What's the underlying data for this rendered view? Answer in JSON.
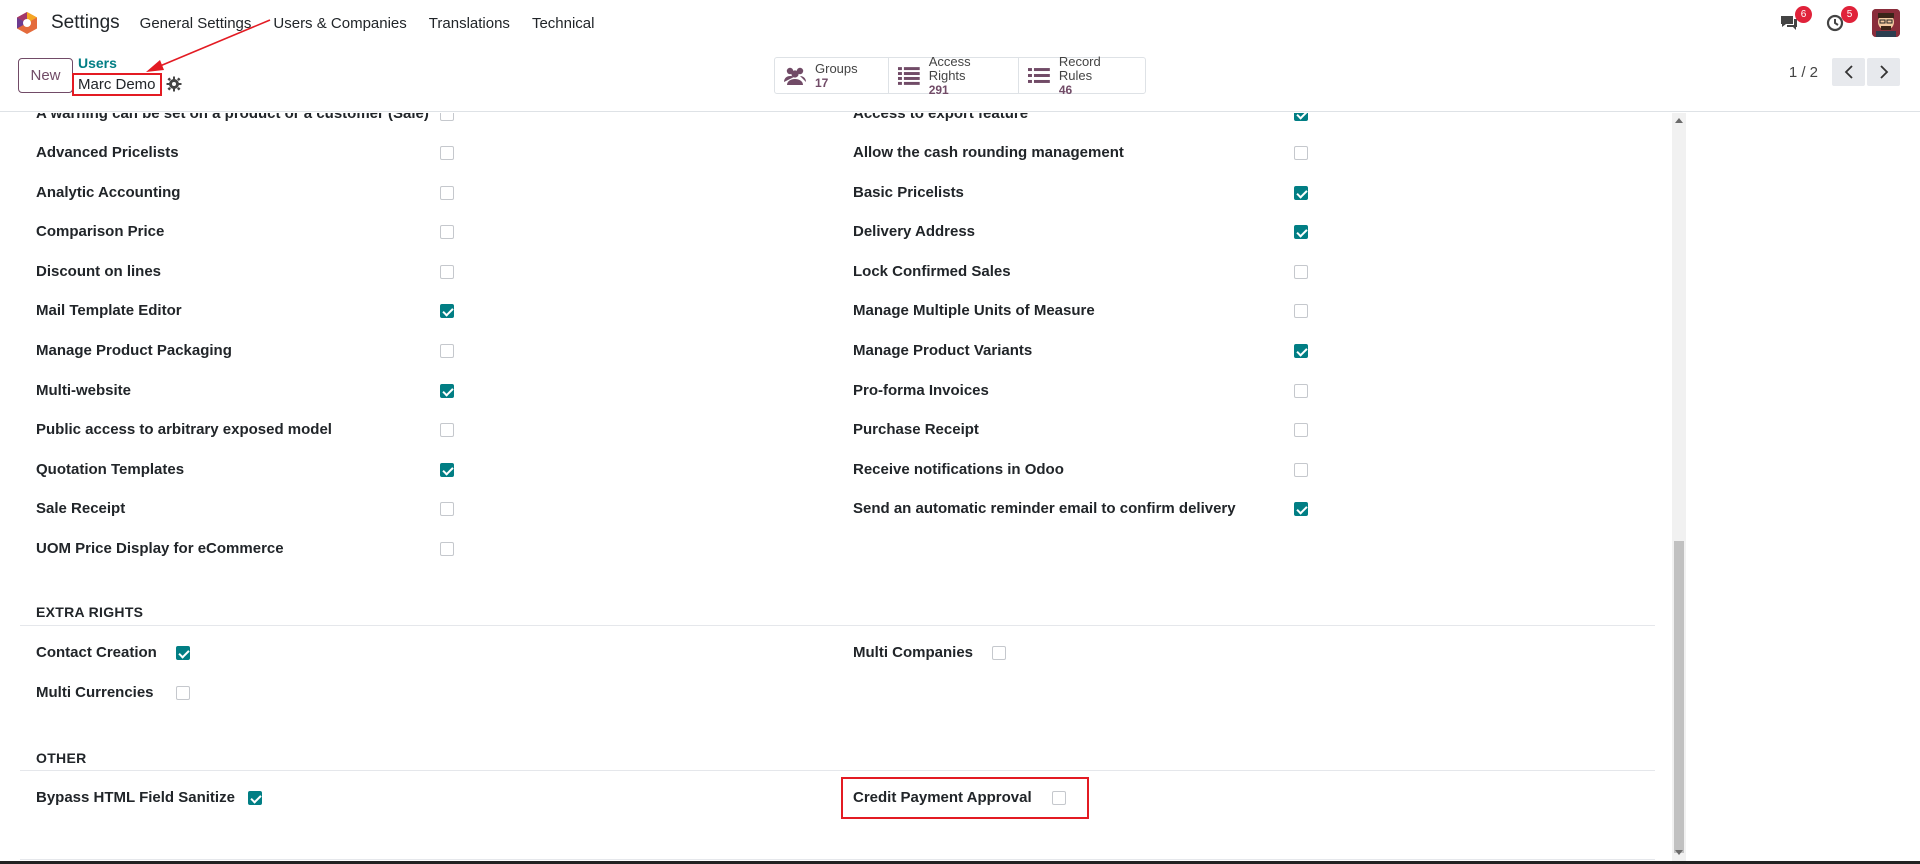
{
  "navbar": {
    "app_title": "Settings",
    "menu": [
      "General Settings",
      "Users & Companies",
      "Translations",
      "Technical"
    ],
    "messages_badge": "6",
    "activities_badge": "5"
  },
  "control_panel": {
    "new_label": "New",
    "breadcrumb_parent": "Users",
    "breadcrumb_current": "Marc Demo",
    "smart_buttons": [
      {
        "label": "Groups",
        "value": "17",
        "icon": "users-icon"
      },
      {
        "label": "Access Rights",
        "value": "291",
        "icon": "list-icon"
      },
      {
        "label": "Record Rules",
        "value": "46",
        "icon": "list-icon"
      }
    ],
    "pager": "1 / 2"
  },
  "technical_rights": {
    "left": [
      {
        "label": "A warning can be set on a product or a customer (Sale)",
        "checked": false
      },
      {
        "label": "Advanced Pricelists",
        "checked": false
      },
      {
        "label": "Analytic Accounting",
        "checked": false
      },
      {
        "label": "Comparison Price",
        "checked": false
      },
      {
        "label": "Discount on lines",
        "checked": false
      },
      {
        "label": "Mail Template Editor",
        "checked": true
      },
      {
        "label": "Manage Product Packaging",
        "checked": false
      },
      {
        "label": "Multi-website",
        "checked": true
      },
      {
        "label": "Public access to arbitrary exposed model",
        "checked": false
      },
      {
        "label": "Quotation Templates",
        "checked": true
      },
      {
        "label": "Sale Receipt",
        "checked": false
      },
      {
        "label": "UOM Price Display for eCommerce",
        "checked": false
      }
    ],
    "right": [
      {
        "label": "Access to export feature",
        "checked": true
      },
      {
        "label": "Allow the cash rounding management",
        "checked": false
      },
      {
        "label": "Basic Pricelists",
        "checked": true
      },
      {
        "label": "Delivery Address",
        "checked": true
      },
      {
        "label": "Lock Confirmed Sales",
        "checked": false
      },
      {
        "label": "Manage Multiple Units of Measure",
        "checked": false
      },
      {
        "label": "Manage Product Variants",
        "checked": true
      },
      {
        "label": "Pro-forma Invoices",
        "checked": false
      },
      {
        "label": "Purchase Receipt",
        "checked": false
      },
      {
        "label": "Receive notifications in Odoo",
        "checked": false
      },
      {
        "label": "Send an automatic reminder email to confirm delivery",
        "checked": true
      }
    ]
  },
  "extra_rights": {
    "title": "EXTRA RIGHTS",
    "items": [
      {
        "label": "Contact Creation",
        "checked": true
      },
      {
        "label": "Multi Currencies",
        "checked": false
      },
      {
        "label": "Multi Companies",
        "checked": false
      }
    ]
  },
  "other": {
    "title": "OTHER",
    "items": [
      {
        "label": "Bypass HTML Field Sanitize",
        "checked": true
      },
      {
        "label": "Credit Payment Approval",
        "checked": false
      }
    ]
  },
  "colors": {
    "brand": "#714b67",
    "accent": "#017e84",
    "highlight": "#e31b23"
  }
}
